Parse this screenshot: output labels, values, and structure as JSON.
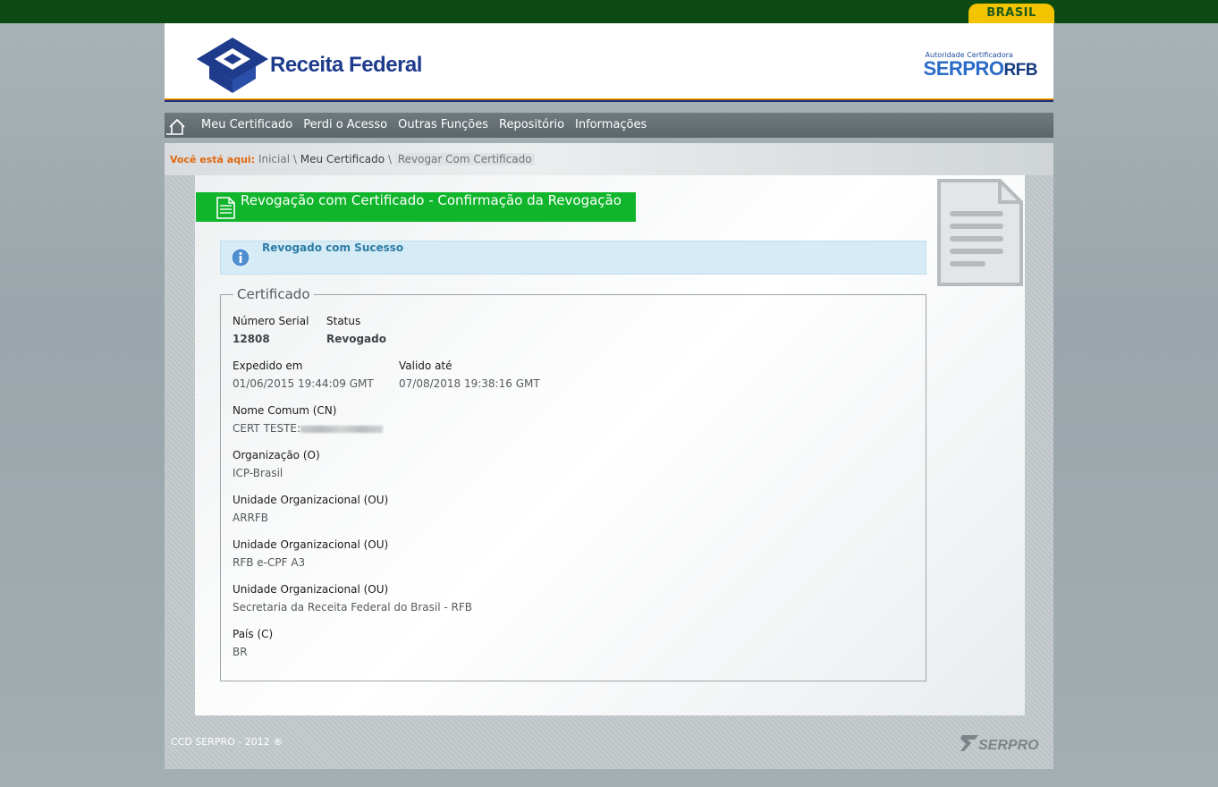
{
  "topbar": {
    "brasil_label": "BRASIL"
  },
  "header": {
    "logo_text": "Receita Federal",
    "serpro_subtitle": "Autoridade Certificadora",
    "serpro_name": "SERPRO",
    "serpro_suffix": "RFB"
  },
  "nav": {
    "items": [
      "Meu Certificado",
      "Perdi o Acesso",
      "Outras Funções",
      "Repositório",
      "Informações"
    ]
  },
  "breadcrumb": {
    "label": "Você está aqui:",
    "items": [
      "Inicial",
      "Meu Certificado",
      "Revogar Com Certificado"
    ],
    "separator": "\\"
  },
  "page": {
    "title": "Revogação com Certificado - Confirmação da Revogação",
    "alert": "Revogado com Sucesso"
  },
  "certificate": {
    "legend": "Certificado",
    "serial_label": "Número Serial",
    "serial_value": "12808",
    "status_label": "Status",
    "status_value": "Revogado",
    "issued_label": "Expedido em",
    "issued_value": "01/06/2015 19:44:09 GMT",
    "valid_label": "Valido até",
    "valid_value": "07/08/2018 19:38:16 GMT",
    "cn_label": "Nome Comum (CN)",
    "cn_value": "CERT TESTE:",
    "o_label": "Organização (O)",
    "o_value": "ICP-Brasil",
    "ou1_label": "Unidade Organizacional (OU)",
    "ou1_value": "ARRFB",
    "ou2_label": "Unidade Organizacional (OU)",
    "ou2_value": "RFB e-CPF A3",
    "ou3_label": "Unidade Organizacional (OU)",
    "ou3_value": "Secretaria da Receita Federal do Brasil - RFB",
    "c_label": "País (C)",
    "c_value": "BR"
  },
  "footer": {
    "copyright": "CCD SERPRO - 2012 ®",
    "logo_text": "SERPRO"
  },
  "colors": {
    "top_green": "#0b4a12",
    "brasil_yellow": "#f4c300",
    "title_green": "#10b52c",
    "alert_bg": "#d5ebf5",
    "breadcrumb_orange": "#e0670c",
    "rf_blue": "#1e3b8c"
  }
}
